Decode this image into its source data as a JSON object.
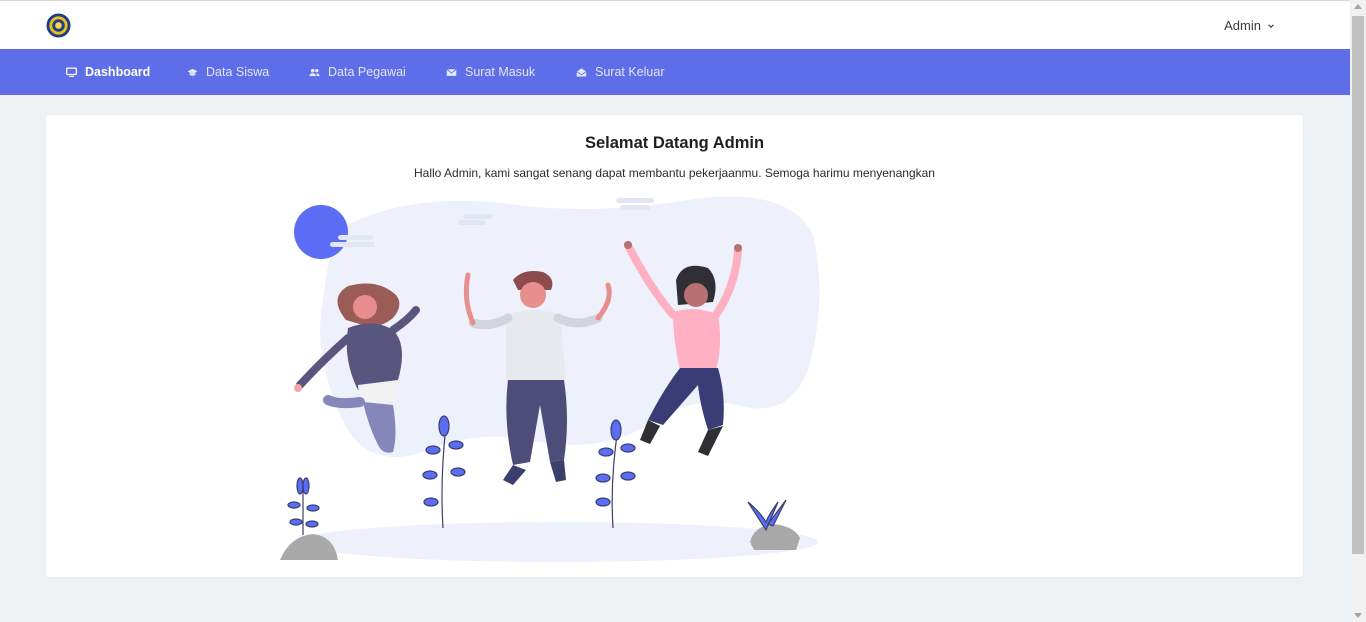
{
  "header": {
    "logo_icon": "school-emblem-icon",
    "user_menu_label": "Admin"
  },
  "nav": {
    "items": [
      {
        "label": "Dashboard",
        "icon": "monitor-icon",
        "active": true
      },
      {
        "label": "Data Siswa",
        "icon": "graduation-cap-icon",
        "active": false
      },
      {
        "label": "Data Pegawai",
        "icon": "users-icon",
        "active": false
      },
      {
        "label": "Surat Masuk",
        "icon": "envelope-icon",
        "active": false
      },
      {
        "label": "Surat Keluar",
        "icon": "envelope-open-icon",
        "active": false
      }
    ]
  },
  "welcome": {
    "title": "Selamat Datang Admin",
    "subtitle": "Hallo Admin, kami sangat senang dapat membantu pekerjaanmu. Semoga harimu menyenangkan"
  },
  "colors": {
    "navbar": "#5e6ee8",
    "background": "#eff2f5",
    "accent": "#5b6cf5"
  }
}
